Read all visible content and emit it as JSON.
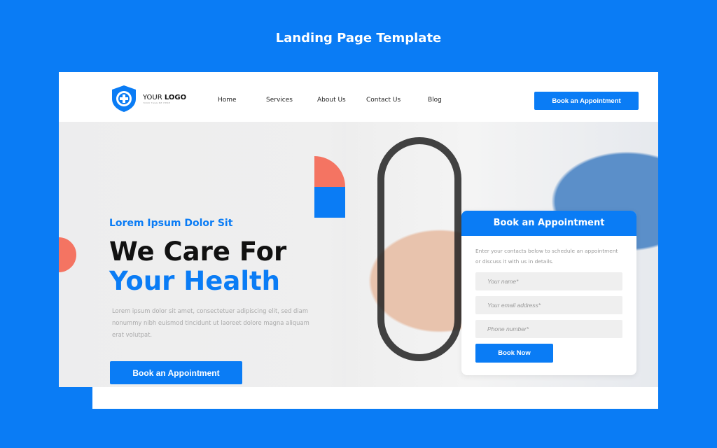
{
  "page_title": "Landing Page Template",
  "logo": {
    "your": "YOUR ",
    "logo": "LOGO",
    "tagline": "YOUR TAGLINE HERE"
  },
  "nav": {
    "items": [
      "Home",
      "Services",
      "About Us",
      "Contact Us",
      "Blog"
    ],
    "cta": "Book an Appointment"
  },
  "hero": {
    "subtitle": "Lorem Ipsum Dolor Sit",
    "title_line1": "We Care For",
    "title_line2": "Your Health",
    "paragraph": "Lorem ipsum dolor sit amet, consectetuer adipiscing elit, sed diam nonummy nibh euismod tincidunt ut laoreet dolore magna aliquam erat volutpat.",
    "cta": "Book an Appointment"
  },
  "social": [
    "twitter-icon",
    "facebook-icon",
    "instagram-icon",
    "youtube-icon"
  ],
  "carousel": {
    "count": 4,
    "active": 0
  },
  "form": {
    "title": "Book an Appointment",
    "description": "Enter your contacts below to schedule an appointment or discuss it with us in details.",
    "name_placeholder": "Your name*",
    "email_placeholder": "Your email address*",
    "phone_placeholder": "Phone number*",
    "submit": "Book Now"
  },
  "colors": {
    "primary": "#0a7cf5",
    "accent": "#f47462"
  }
}
